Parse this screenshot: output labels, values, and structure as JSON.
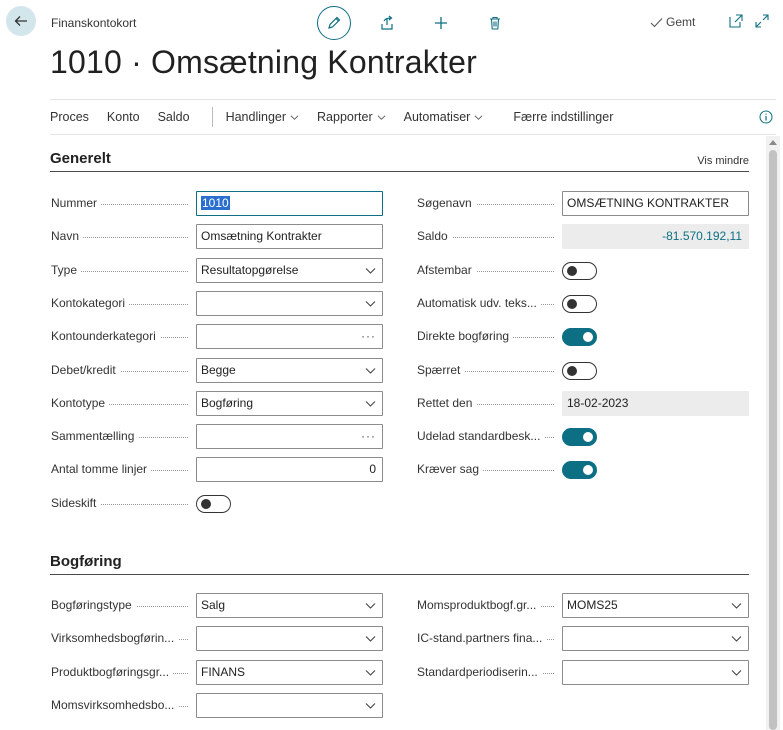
{
  "header": {
    "caption": "Finanskontokort",
    "title": "1010 · Omsætning Kontrakter",
    "saved_label": "Gemt"
  },
  "menu": {
    "items": [
      "Proces",
      "Konto",
      "Saldo"
    ],
    "dropdowns": [
      "Handlinger",
      "Rapporter",
      "Automatiser"
    ],
    "fewer": "Færre indstillinger"
  },
  "general": {
    "title": "Generelt",
    "show_less": "Vis mindre",
    "left": [
      {
        "label": "Nummer",
        "value": "1010",
        "kind": "text"
      },
      {
        "label": "Navn",
        "value": "Omsætning Kontrakter",
        "kind": "text"
      },
      {
        "label": "Type",
        "value": "Resultatopgørelse",
        "kind": "dropdown"
      },
      {
        "label": "Kontokategori",
        "value": "",
        "kind": "dropdown"
      },
      {
        "label": "Kontounderkategori",
        "value": "",
        "kind": "lookup"
      },
      {
        "label": "Debet/kredit",
        "value": "Begge",
        "kind": "dropdown"
      },
      {
        "label": "Kontotype",
        "value": "Bogføring",
        "kind": "dropdown"
      },
      {
        "label": "Sammentælling",
        "value": "",
        "kind": "lookup"
      },
      {
        "label": "Antal tomme linjer",
        "value": "0",
        "kind": "number"
      },
      {
        "label": "Sideskift",
        "on": false,
        "kind": "toggle"
      }
    ],
    "right": [
      {
        "label": "Søgenavn",
        "value": "OMSÆTNING KONTRAKTER",
        "kind": "text"
      },
      {
        "label": "Saldo",
        "value": "-81.570.192,11",
        "kind": "readonly-number"
      },
      {
        "label": "Afstembar",
        "on": false,
        "kind": "toggle"
      },
      {
        "label": "Automatisk udv. teks...",
        "on": false,
        "kind": "toggle"
      },
      {
        "label": "Direkte bogføring",
        "on": true,
        "kind": "toggle"
      },
      {
        "label": "Spærret",
        "on": false,
        "kind": "toggle"
      },
      {
        "label": "Rettet den",
        "value": "18-02-2023",
        "kind": "readonly"
      },
      {
        "label": "Udelad standardbesk...",
        "on": true,
        "kind": "toggle"
      },
      {
        "label": "Kræver sag",
        "on": true,
        "kind": "toggle"
      }
    ]
  },
  "posting": {
    "title": "Bogføring",
    "left": [
      {
        "label": "Bogføringstype",
        "value": "Salg",
        "kind": "dropdown"
      },
      {
        "label": "Virksomhedsbogførin...",
        "value": "",
        "kind": "dropdown"
      },
      {
        "label": "Produktbogføringsgr...",
        "value": "FINANS",
        "kind": "dropdown"
      },
      {
        "label": "Momsvirksomhedsbo...",
        "value": "",
        "kind": "dropdown"
      }
    ],
    "right": [
      {
        "label": "Momsproduktbogf.gr...",
        "value": "MOMS25",
        "kind": "dropdown"
      },
      {
        "label": "IC-stand.partners fina...",
        "value": "",
        "kind": "dropdown"
      },
      {
        "label": "Standardperiodiserin...",
        "value": "",
        "kind": "dropdown"
      }
    ]
  },
  "colors": {
    "accent": "#0d6f83",
    "back_bg": "#d3e6ec"
  }
}
